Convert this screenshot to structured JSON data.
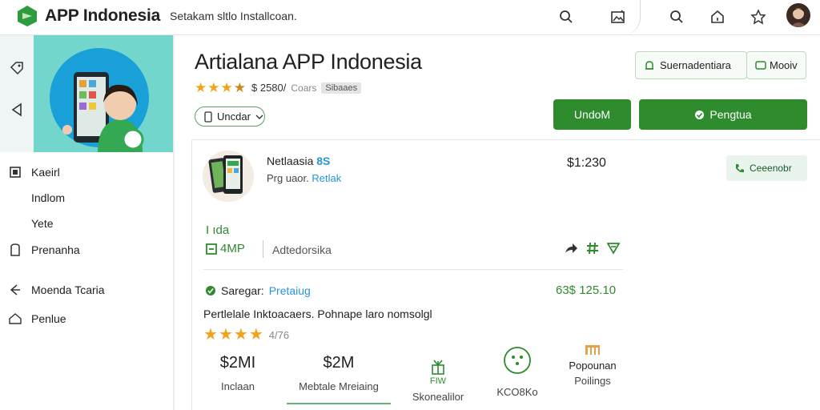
{
  "topbar": {
    "brand": "APP Indonesia",
    "search_text": "Setakam sltlo Installcoan."
  },
  "sidebar": {
    "items": [
      {
        "label": "Kaeirl",
        "icon": "square-icon"
      },
      {
        "label": "Indlom",
        "icon": ""
      },
      {
        "label": "Yete",
        "icon": ""
      },
      {
        "label": "Prenanha",
        "icon": "bookmark-icon"
      },
      {
        "label": "Moenda Tcaria",
        "icon": "share-icon"
      },
      {
        "label": "Penlue",
        "icon": "home-icon"
      }
    ]
  },
  "header": {
    "title": "Artialana APP Indonesia",
    "rating_text": "$ 2580/",
    "rating_sub": "Coars",
    "chip": "Sibaaes",
    "dropdown": "Uncdar"
  },
  "actions": {
    "outline_1": "Suernadentiara",
    "outline_2": "Mooiv",
    "green_1": "UndoM",
    "green_2": "Pengtua"
  },
  "product": {
    "name": "Netlaasia",
    "name_tag": "8S",
    "sub_prefix": "Prg uaor.",
    "sub_link": "Retlak",
    "price": "$1:230",
    "call_button": "Ceeenobr",
    "ida": "I ıda",
    "amp": "4MP",
    "address": "Adtedorsika",
    "savings_label": "Saregar:",
    "savings_link": "Pretaiug",
    "savings_price": "63$ 125.10",
    "description": "Pertlelale Inktoacaers. Pohnape laro nomsolgl",
    "rating_value": "4/76"
  },
  "stats": [
    {
      "value": "$2MI",
      "label": "Inclaan"
    },
    {
      "value": "$2M",
      "label": "Mebtale Mreiaing"
    },
    {
      "icon_text": "FIW",
      "label": "Skonealilor"
    },
    {
      "label": "KCO8Ko"
    },
    {
      "icon_text": "Popounan",
      "label": "Poilings"
    }
  ],
  "colors": {
    "brand_green": "#2e8b2e",
    "link_blue": "#2a95d6",
    "star": "#f2a31b",
    "hero_teal": "#72d6cd"
  }
}
